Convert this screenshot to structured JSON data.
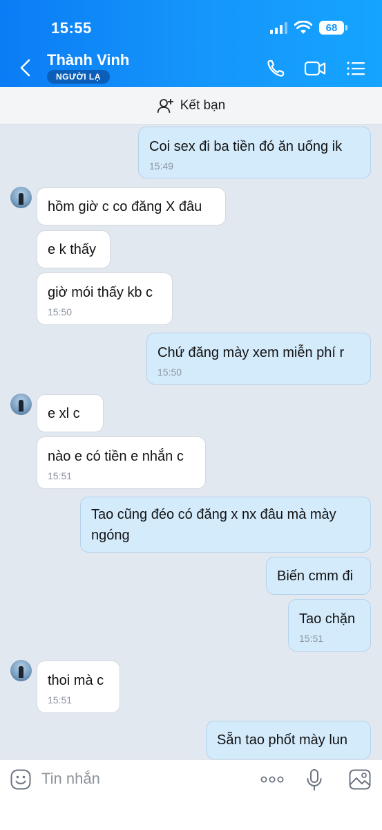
{
  "status_bar": {
    "time": "15:55",
    "battery": "68"
  },
  "header": {
    "contact_name": "Thành Vinh",
    "badge": "NGƯỜI LẠ"
  },
  "friend_bar": {
    "label": "Kết bạn"
  },
  "messages": [
    {
      "text": "Coi sex đi ba tiền đó ăn uống ik",
      "time": "15:49"
    },
    {
      "text": "hồm giờ c co đăng X đâu"
    },
    {
      "text": "e k thấy"
    },
    {
      "text": "giờ mói thấy kb c",
      "time": "15:50"
    },
    {
      "text": "Chứ đăng mày xem miễn phí r",
      "time": "15:50"
    },
    {
      "text": "e xl c"
    },
    {
      "text": "nào e có tiền e nhắn c",
      "time": "15:51"
    },
    {
      "text": "Tao cũng đéo có đăng x nx đâu mà mày ngóng"
    },
    {
      "text": "Biến cmm đi"
    },
    {
      "text": "Tao chặn",
      "time": "15:51"
    },
    {
      "text": "thoi mà c",
      "time": "15:51"
    },
    {
      "text": "Sẵn tao phốt mày lun"
    }
  ],
  "input": {
    "placeholder": "Tin nhắn"
  },
  "colors": {
    "header_blue": "#1595fb",
    "outgoing_bubble": "#d4ebfc",
    "incoming_bubble": "#ffffff",
    "chat_bg": "#e2e8f0"
  },
  "icons": [
    "back-icon",
    "phone-icon",
    "video-call-icon",
    "menu-list-icon",
    "add-friend-icon",
    "emoji-icon",
    "more-icon",
    "microphone-icon",
    "image-icon"
  ]
}
